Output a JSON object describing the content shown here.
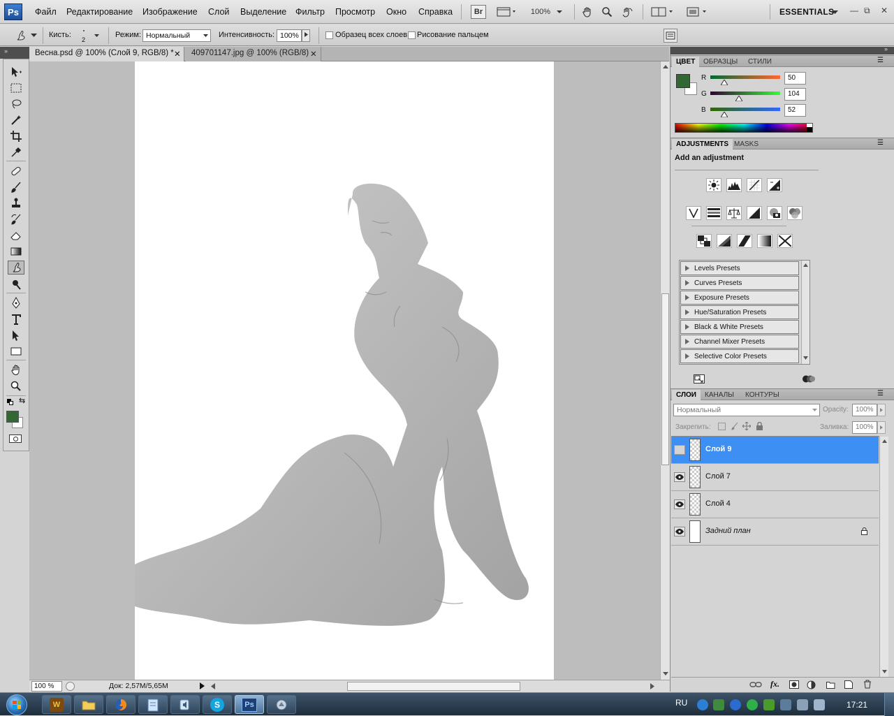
{
  "app": {
    "logo": "Ps",
    "workspace": "ESSENTIALS",
    "zoom_select": "100%",
    "bridge_label": "Br"
  },
  "menu": [
    "Файл",
    "Редактирование",
    "Изображение",
    "Слой",
    "Выделение",
    "Фильтр",
    "Просмотр",
    "Окно",
    "Справка"
  ],
  "options_bar": {
    "brush_label": "Кисть:",
    "brush_size": "2",
    "mode_label": "Режим:",
    "mode_value": "Нормальный",
    "strength_label": "Интенсивность:",
    "strength_value": "100%",
    "sample_all_label": "Образец всех слоев",
    "finger_painting_label": "Рисование пальцем"
  },
  "documents": [
    {
      "title": "Весна.psd @ 100% (Слой 9, RGB/8) *",
      "active": true
    },
    {
      "title": "409701147.jpg @ 100% (RGB/8)",
      "active": false
    }
  ],
  "status": {
    "zoom": "100 %",
    "doc_size": "Док: 2,57M/5,65M"
  },
  "color_panel": {
    "tabs": [
      "ЦВЕТ",
      "ОБРАЗЦЫ",
      "СТИЛИ"
    ],
    "channels": [
      {
        "name": "R",
        "value": "50",
        "fraction": 0.196
      },
      {
        "name": "G",
        "value": "104",
        "fraction": 0.408
      },
      {
        "name": "B",
        "value": "52",
        "fraction": 0.204
      }
    ],
    "foreground": "#326834",
    "background": "#ffffff"
  },
  "adjustments_panel": {
    "tabs": [
      "ADJUSTMENTS",
      "MASKS"
    ],
    "heading": "Add an adjustment",
    "presets": [
      "Levels Presets",
      "Curves Presets",
      "Exposure Presets",
      "Hue/Saturation Presets",
      "Black & White Presets",
      "Channel Mixer Presets",
      "Selective Color Presets"
    ]
  },
  "layers_panel": {
    "tabs": [
      "СЛОИ",
      "КАНАЛЫ",
      "КОНТУРЫ"
    ],
    "blend_mode": "Нормальный",
    "opacity_label": "Opacity:",
    "opacity_value": "100%",
    "lock_label": "Закрепить:",
    "fill_label": "Заливка:",
    "fill_value": "100%",
    "layers": [
      {
        "name": "Слой 9",
        "visible": false,
        "selected": true
      },
      {
        "name": "Слой 7",
        "visible": true,
        "selected": false
      },
      {
        "name": "Слой 4",
        "visible": true,
        "selected": false
      },
      {
        "name": "Задний план",
        "visible": true,
        "selected": false,
        "locked": true
      }
    ]
  },
  "taskbar": {
    "apps": [
      "W",
      "",
      "",
      "",
      "S",
      "Ps",
      ""
    ],
    "language": "RU",
    "clock": "17:21"
  }
}
